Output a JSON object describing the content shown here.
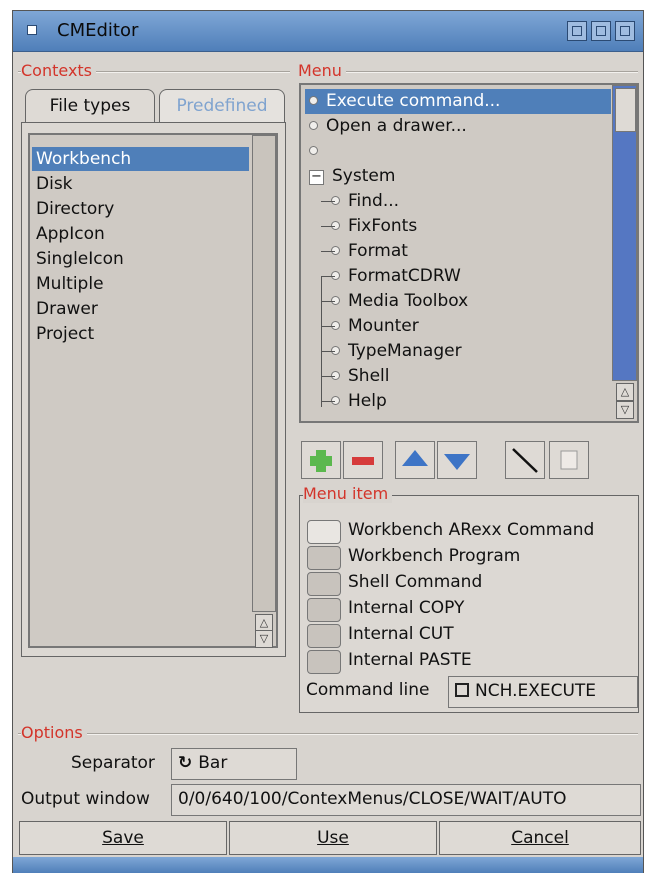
{
  "window": {
    "title": "CMEditor"
  },
  "contexts": {
    "label": "Contexts",
    "tabs": [
      {
        "label": "File types",
        "active": false
      },
      {
        "label": "Predefined",
        "active": true
      }
    ],
    "items": [
      "Workbench",
      "Disk",
      "Directory",
      "AppIcon",
      "SingleIcon",
      "Multiple",
      "Drawer",
      "Project"
    ],
    "selected": "Workbench"
  },
  "menu": {
    "label": "Menu",
    "items": [
      {
        "label": "Execute command...",
        "level": 0,
        "selected": true
      },
      {
        "label": "Open a drawer...",
        "level": 0
      },
      {
        "label": "",
        "level": 0
      },
      {
        "label": "System",
        "level": 0,
        "expandable": true,
        "expander": "−"
      },
      {
        "label": "Find...",
        "level": 1
      },
      {
        "label": "FixFonts",
        "level": 1
      },
      {
        "label": "Format",
        "level": 1
      },
      {
        "label": "FormatCDRW",
        "level": 1
      },
      {
        "label": "Media Toolbox",
        "level": 1
      },
      {
        "label": "Mounter",
        "level": 1
      },
      {
        "label": "TypeManager",
        "level": 1
      },
      {
        "label": "Shell",
        "level": 1
      },
      {
        "label": "Help",
        "level": 1
      }
    ],
    "toolbar": [
      "add-icon",
      "remove-icon",
      "move-up-icon",
      "move-down-icon",
      "separator-line-icon",
      "page-icon"
    ]
  },
  "menu_item": {
    "label": "Menu item",
    "options": [
      {
        "label": "Workbench ARexx Command",
        "checked": true
      },
      {
        "label": "Workbench Program",
        "checked": false
      },
      {
        "label": "Shell Command",
        "checked": false
      },
      {
        "label": "Internal COPY",
        "checked": false
      },
      {
        "label": "Internal CUT",
        "checked": false
      },
      {
        "label": "Internal PASTE",
        "checked": false
      }
    ],
    "command_line_label": "Command line",
    "command_line_value": "NCH.EXECUTE"
  },
  "options": {
    "label": "Options",
    "separator_label": "Separator",
    "separator_value": "Bar",
    "output_label": "Output window",
    "output_value": "0/0/640/100/ContexMenus/CLOSE/WAIT/AUTO"
  },
  "buttons": {
    "save": "Save",
    "use": "Use",
    "cancel": "Cancel"
  },
  "colors": {
    "accent": "#4f7fb9",
    "group_label": "#d3342a"
  }
}
